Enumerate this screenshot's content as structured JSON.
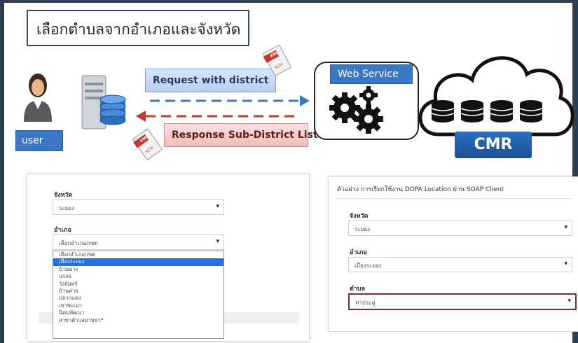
{
  "header": {
    "title": "เลือกตำบลจากอำเภอและจังหวัด"
  },
  "diagram": {
    "user_label": "user",
    "request_label": "Request with district",
    "response_label": "Response Sub-District List",
    "web_service_label": "Web Service",
    "cmr_label": "CMR",
    "xml_tag": "XML",
    "xml_glyph": "</>",
    "colors": {
      "accent_blue": "#3a77c5",
      "request_arrow": "#3a77c5",
      "response_arrow": "#c0392b",
      "cmr_blue": "#1d4f94"
    }
  },
  "form_left": {
    "province_label": "จังหวัด",
    "province_value": "ระยอง",
    "district_label": "อำเภอ",
    "district_value": "เลือกอำเภอ/เขต",
    "district_options": [
      "เลือกอำเภอ/เขต",
      "เมืองระยอง",
      "บ้านฉาง",
      "แกลง",
      "วังจันทร์",
      "บ้านค่าย",
      "ปลวกแดง",
      "เขาชะเมา",
      "นิคมพัฒนา",
      "สาขาตำบลมาบข่า*"
    ],
    "highlighted_option": "เมืองระยอง"
  },
  "form_right": {
    "title": "ตัวอย่าง การเรียกใช้งาน DOPA Location ผ่าน SOAP Client",
    "province_label": "จังหวัด",
    "province_value": "ระยอง",
    "district_label": "อำเภอ",
    "district_value": "เมืองระยอง",
    "subdistrict_label": "ตำบล",
    "subdistrict_value": "ท่าประดู่"
  },
  "icons": {
    "dropdown_caret": "▾"
  }
}
